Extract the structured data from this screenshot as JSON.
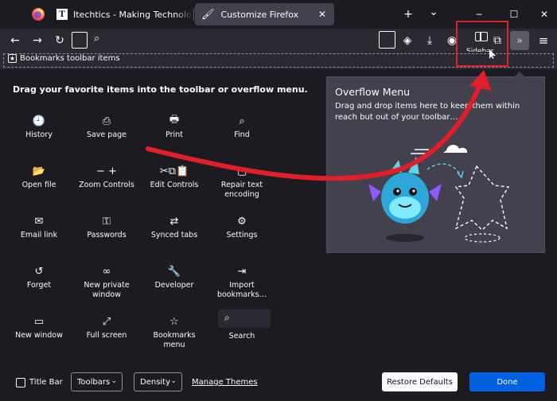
{
  "tabs": [
    {
      "favicon": "T",
      "title": "Itechtics - Making Technology Work"
    },
    {
      "favicon": "paint-brush-icon",
      "title": "Customize Firefox",
      "close": "✕"
    }
  ],
  "window_controls": {
    "new_tab": "+",
    "list_tabs": "⌄",
    "minimize": "─",
    "maximize": "☐",
    "close": "✕"
  },
  "navbar": {
    "back": "←",
    "forward": "→",
    "reload": "↻",
    "search_glyph": "⌕",
    "pocket": "◈",
    "downloads": "⤓",
    "account": "◉",
    "extensions": "⧉",
    "overflow": "»",
    "menu": "≡",
    "sidebar_label": "Sidebar"
  },
  "bookmarks_bar": {
    "star": "★",
    "label": "Bookmarks toolbar items"
  },
  "palette": {
    "heading": "Drag your favorite items into the toolbar or overflow menu.",
    "items": [
      {
        "icon": "🕘",
        "label": "History"
      },
      {
        "icon": "⎙",
        "label": "Save page"
      },
      {
        "icon": "🖶",
        "label": "Print"
      },
      {
        "icon": "⌕",
        "label": "Find"
      },
      {
        "icon": "📂",
        "label": "Open file"
      },
      {
        "icon": "− +",
        "label": "Zoom Controls"
      },
      {
        "icon": "✂⧉📋",
        "label": "Edit Controls"
      },
      {
        "icon": "▢",
        "label": "Repair text encoding"
      },
      {
        "icon": "✉",
        "label": "Email link"
      },
      {
        "icon": "⚿",
        "label": "Passwords"
      },
      {
        "icon": "⇄",
        "label": "Synced tabs"
      },
      {
        "icon": "⚙",
        "label": "Settings"
      },
      {
        "icon": "↺",
        "label": "Forget"
      },
      {
        "icon": "∞",
        "label": "New private window"
      },
      {
        "icon": "🔧",
        "label": "Developer"
      },
      {
        "icon": "⇥",
        "label": "Import bookmarks…"
      },
      {
        "icon": "▭",
        "label": "New window"
      },
      {
        "icon": "⤢",
        "label": "Full screen"
      },
      {
        "icon": "☆",
        "label": "Bookmarks menu"
      },
      {
        "icon": "⌕",
        "label": "Search"
      }
    ]
  },
  "overflow_menu": {
    "title": "Overflow Menu",
    "description": "Drag and drop items here to keep them within reach but out of your toolbar…"
  },
  "footer": {
    "title_bar": "Title Bar",
    "toolbars": "Toolbars",
    "density": "Density",
    "chevron": "⌄",
    "manage_themes": "Manage Themes",
    "restore_defaults": "Restore Defaults",
    "done": "Done"
  },
  "colors": {
    "accent": "#0061e0",
    "annotation": "#e01f2a",
    "background": "#1c1b22",
    "toolbar": "#2b2a33"
  }
}
